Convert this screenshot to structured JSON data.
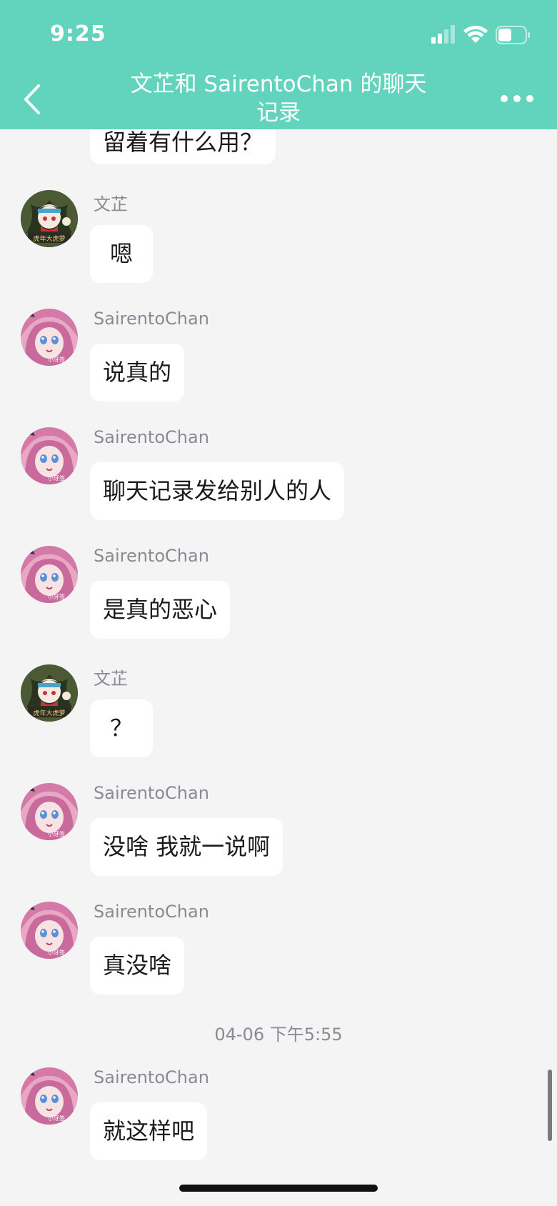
{
  "status_bar": {
    "time": "9:25"
  },
  "header": {
    "title_line1": "文芷和 SairentoChan 的聊天",
    "title_line2": "记录",
    "back_icon": "chevron-left-icon",
    "more_icon": "more-horizontal-icon"
  },
  "colors": {
    "header_bg": "#62d4bd",
    "chat_bg": "#f4f4f4",
    "bubble_bg": "#ffffff"
  },
  "messages": [
    {
      "text": "留着有什么用？"
    },
    {
      "sender": "文芷",
      "text": "嗯"
    },
    {
      "sender": "SairentoChan",
      "text": "说真的"
    },
    {
      "sender": "SairentoChan",
      "text": "聊天记录发给别人的人"
    },
    {
      "sender": "SairentoChan",
      "text": "是真的恶心"
    },
    {
      "sender": "文芷",
      "text": "？"
    },
    {
      "sender": "SairentoChan",
      "text": "没啥 我就一说啊"
    },
    {
      "sender": "SairentoChan",
      "text": "真没啥"
    },
    {
      "sender": "SairentoChan",
      "text": "就这样吧"
    }
  ],
  "timestamp": "04-06 下午5:55",
  "avatars": {
    "wenzhi_caption": "虎年大虎萝",
    "sairento_caption": "小牙签"
  }
}
